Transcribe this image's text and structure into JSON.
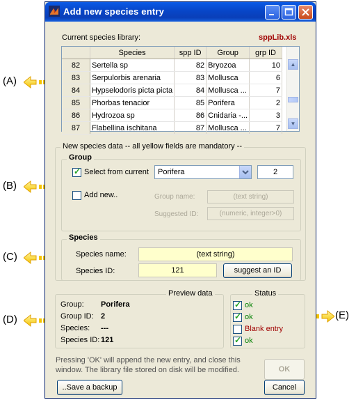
{
  "window": {
    "title": "Add new species entry",
    "library_label": "Current species library:",
    "library_file": "sppLib.xls"
  },
  "table": {
    "columns": [
      "Species",
      "spp ID",
      "Group",
      "grp ID"
    ],
    "rows": [
      {
        "n": "82",
        "species": "Sertella sp",
        "spp_id": "82",
        "group": "Bryozoa",
        "grp_id": "10"
      },
      {
        "n": "83",
        "species": "Serpulorbis arenaria",
        "spp_id": "83",
        "group": "Mollusca",
        "grp_id": "6"
      },
      {
        "n": "84",
        "species": "Hypselodoris picta picta",
        "spp_id": "84",
        "group": "Mollusca ...",
        "grp_id": "7"
      },
      {
        "n": "85",
        "species": "Phorbas tenacior",
        "spp_id": "85",
        "group": "Porifera",
        "grp_id": "2"
      },
      {
        "n": "86",
        "species": "Hydrozoa sp",
        "spp_id": "86",
        "group": "Cnidaria -...",
        "grp_id": "3"
      },
      {
        "n": "87",
        "species": "Flabellina ischitana",
        "spp_id": "87",
        "group": "Mollusca ...",
        "grp_id": "7"
      }
    ]
  },
  "new_data": {
    "title": "New species data  -- all yellow fields are mandatory --",
    "group": {
      "title": "Group",
      "select_current_label": "Select from current",
      "select_current_checked": true,
      "group_selected": "Porifera",
      "group_id": "2",
      "add_new_label": "Add new..",
      "add_new_checked": false,
      "group_name_label": "Group name:",
      "group_name_placeholder": "(text string)",
      "suggested_id_label": "Suggested ID:",
      "suggested_id_placeholder": "(numeric, integer>0)"
    },
    "species": {
      "title": "Species",
      "name_label": "Species name:",
      "name_placeholder": "(text string)",
      "id_label": "Species ID:",
      "id_value": "121",
      "suggest_button": "suggest an ID"
    }
  },
  "preview": {
    "title": "Preview data",
    "group_label": "Group:",
    "group_value": "Porifera",
    "group_id_label": "Group ID:",
    "group_id_value": "2",
    "species_label": "Species:",
    "species_value": "---",
    "species_id_label": "Species ID:",
    "species_id_value": "121"
  },
  "status": {
    "title": "Status",
    "items": [
      {
        "text": "ok",
        "checked": true,
        "color": "#008000"
      },
      {
        "text": "ok",
        "checked": true,
        "color": "#008000"
      },
      {
        "text": "Blank entry",
        "checked": false,
        "color": "#a00000"
      },
      {
        "text": "ok",
        "checked": true,
        "color": "#008000"
      }
    ]
  },
  "footer": {
    "message": "Pressing 'OK' will append the new entry, and close this window. The library file stored on disk will be modified.",
    "ok_label": "OK",
    "save_backup_label": "..Save a backup",
    "cancel_label": "Cancel"
  },
  "callouts": {
    "a": "(A)",
    "b": "(B)",
    "c": "(C)",
    "d": "(D)",
    "e": "(E)"
  },
  "colors": {
    "title_bar": "#0846c8",
    "mandatory_field": "#ffffcc",
    "file_name": "#a00000",
    "arrow": "#ffd21e"
  }
}
